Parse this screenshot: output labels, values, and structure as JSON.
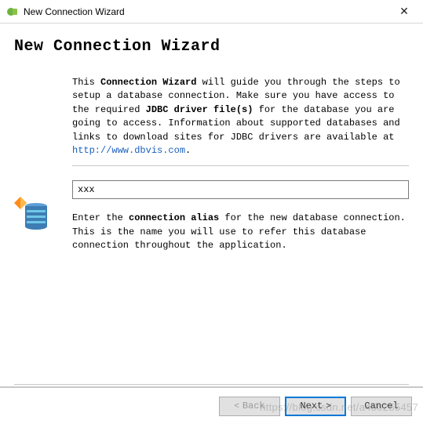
{
  "titlebar": {
    "title": "New Connection Wizard"
  },
  "heading": "New Connection Wizard",
  "intro": {
    "part1": "This ",
    "bold1": "Connection Wizard",
    "part2": " will guide you through the steps to setup a database connection. Make sure you have access to the required ",
    "bold2": "JDBC driver file(s)",
    "part3": " for the database you are going to access. Information about supported databases and links to download sites for JDBC drivers are available at ",
    "link_text": "http://www.dbvis.com",
    "part4": "."
  },
  "input": {
    "value": "xxx"
  },
  "help": {
    "part1": "Enter the ",
    "bold1": "connection alias",
    "part2": " for the new database connection. This is the name you will use to refer this database connection throughout the application."
  },
  "buttons": {
    "back": "Back",
    "next": "Next",
    "cancel": "Cancel"
  },
  "watermark": "https://blog.csdn.net/a450255457"
}
